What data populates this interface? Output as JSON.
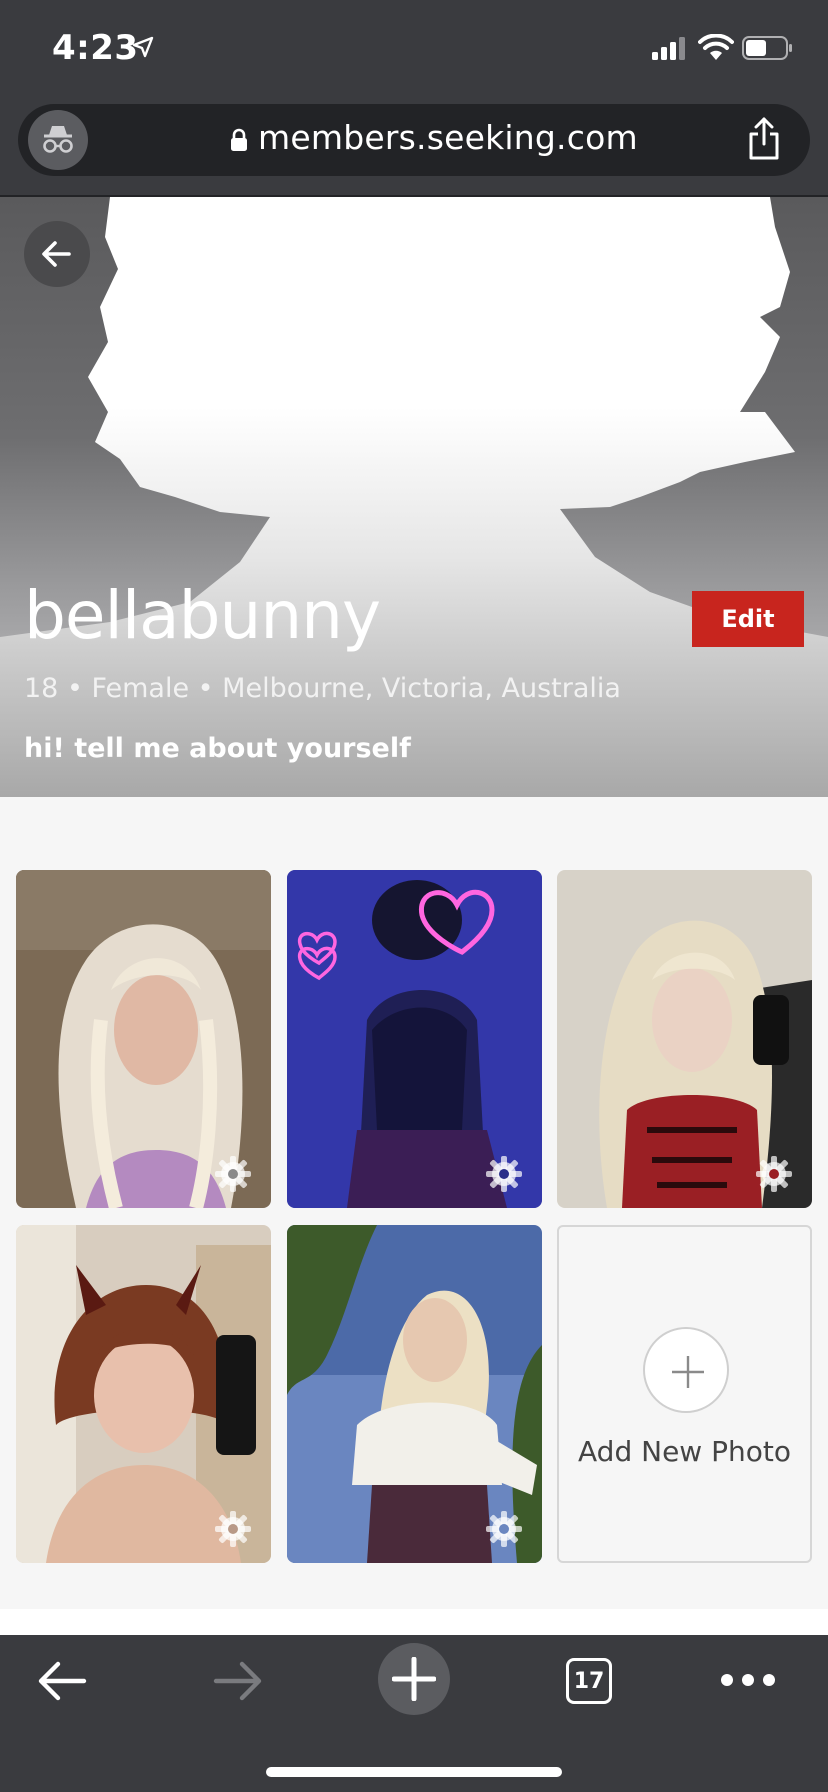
{
  "status_bar": {
    "time": "4:23"
  },
  "browser": {
    "url": "members.seeking.com",
    "tab_count": "17"
  },
  "profile": {
    "username": "bellabunny",
    "edit_label": "Edit",
    "details": "18 • Female • Melbourne, Victoria, Australia",
    "bio": "hi! tell me about yourself"
  },
  "photos": {
    "add_label": "Add New Photo",
    "items": [
      {
        "name": "photo-1",
        "settings_icon": "gear-icon"
      },
      {
        "name": "photo-2",
        "settings_icon": "gear-icon"
      },
      {
        "name": "photo-3",
        "settings_icon": "gear-icon"
      },
      {
        "name": "photo-4",
        "settings_icon": "gear-icon"
      },
      {
        "name": "photo-5",
        "settings_icon": "gear-icon"
      }
    ]
  },
  "colors": {
    "accent": "#c8251e",
    "chrome": "#3a3b3f",
    "section_bg": "#f6f6f6"
  }
}
